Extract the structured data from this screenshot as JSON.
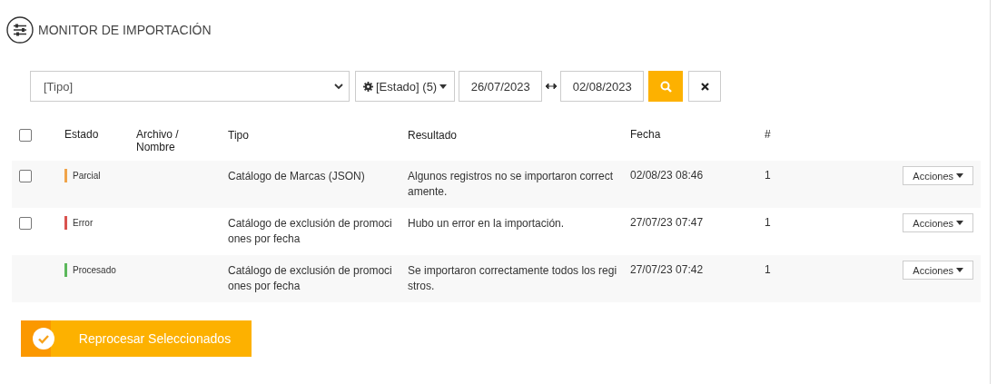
{
  "header": {
    "title": "MONITOR DE IMPORTACIÓN"
  },
  "filters": {
    "type_select": {
      "value": "[Tipo]"
    },
    "status_button": {
      "label": "[Estado] (5)"
    },
    "date_from": {
      "value": "26/07/2023"
    },
    "date_to": {
      "value": "02/08/2023"
    }
  },
  "table": {
    "select_all": {
      "checked": false
    },
    "columns": [
      "Estado",
      "Archivo / Nombre",
      "Tipo",
      "Resultado",
      "Fecha",
      "#"
    ],
    "rows": [
      {
        "checkbox": {
          "checked": false
        },
        "status": "Parcial",
        "color": "#f0a44a",
        "tipo": "Catálogo de Marcas (JSON)",
        "resultado": "Algunos registros no se importaron correctamente.",
        "fecha": "02/08/23 08:46",
        "count": "1",
        "action": "Acciones"
      },
      {
        "checkbox": {
          "checked": false
        },
        "status": "Error",
        "color": "#d9534f",
        "tipo": "Catálogo de exclusión de promociones por fecha",
        "resultado": "Hubo un error en la importación.",
        "fecha": "27/07/23 07:47",
        "count": "1",
        "action": "Acciones"
      },
      {
        "status": "Procesado",
        "color": "#5cb85c",
        "tipo": "Catálogo de exclusión de promociones por fecha",
        "resultado": "Se importaron correctamente todos los registros.",
        "fecha": "27/07/23 07:42",
        "count": "1",
        "action": "Acciones"
      }
    ]
  },
  "reprocess_button": {
    "label": "Reprocesar Seleccionados"
  }
}
